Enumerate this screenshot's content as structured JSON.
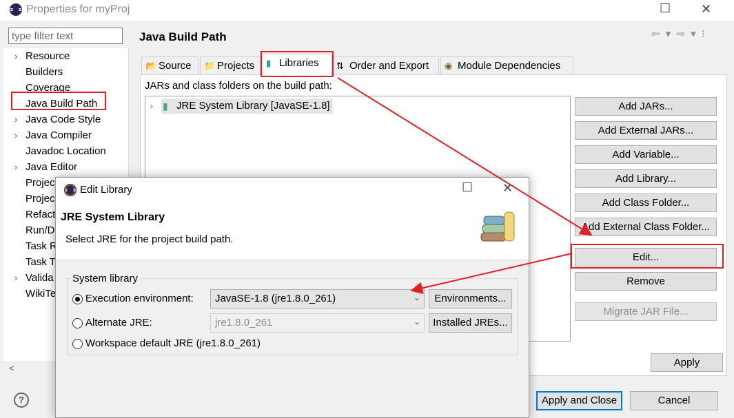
{
  "window": {
    "title": "Properties for myProj",
    "minimize": "—",
    "maximize": "☐",
    "close": "✕"
  },
  "filter": {
    "placeholder": "type filter text"
  },
  "tree": {
    "items": [
      {
        "label": "Resource",
        "arrow": true
      },
      {
        "label": "Builders",
        "arrow": false
      },
      {
        "label": "Coverage",
        "arrow": false
      },
      {
        "label": "Java Build Path",
        "arrow": false,
        "selected": true
      },
      {
        "label": "Java Code Style",
        "arrow": true
      },
      {
        "label": "Java Compiler",
        "arrow": true
      },
      {
        "label": "Javadoc Location",
        "arrow": false
      },
      {
        "label": "Java Editor",
        "arrow": true
      },
      {
        "label": "Projec",
        "arrow": false
      },
      {
        "label": "Projec",
        "arrow": false
      },
      {
        "label": "Refact",
        "arrow": false
      },
      {
        "label": "Run/D",
        "arrow": false
      },
      {
        "label": "Task R",
        "arrow": false
      },
      {
        "label": "Task T",
        "arrow": false
      },
      {
        "label": "Valida",
        "arrow": true
      },
      {
        "label": "WikiTe",
        "arrow": false
      }
    ]
  },
  "page": {
    "title": "Java Build Path",
    "nav_arrows": "⇦ ▾ ⇨ ▾ ⁝"
  },
  "tabs": [
    {
      "label": "Source",
      "icon": "source-folder-icon"
    },
    {
      "label": "Projects",
      "icon": "projects-icon"
    },
    {
      "label": "Libraries",
      "icon": "libraries-icon",
      "active": true
    },
    {
      "label": "Order and Export",
      "icon": "order-export-icon"
    },
    {
      "label": "Module Dependencies",
      "icon": "module-icon"
    }
  ],
  "libraries": {
    "caption": "JARs and class folders on the build path:",
    "entries": [
      {
        "label": "JRE System Library [JavaSE-1.8]"
      }
    ]
  },
  "buttons": {
    "add_jars": "Add JARs...",
    "add_external_jars": "Add External JARs...",
    "add_variable": "Add Variable...",
    "add_library": "Add Library...",
    "add_class_folder": "Add Class Folder...",
    "add_external_class_folder": "Add External Class Folder...",
    "edit": "Edit...",
    "remove": "Remove",
    "migrate_jar": "Migrate JAR File...",
    "apply": "Apply",
    "apply_and_close": "Apply and Close",
    "cancel": "Cancel",
    "help": "?"
  },
  "dialog": {
    "title": "Edit Library",
    "heading": "JRE System Library",
    "description": "Select JRE for the project build path.",
    "group_label": "System library",
    "options": {
      "execution_env": {
        "label": "Execution environment:",
        "value": "JavaSE-1.8 (jre1.8.0_261)",
        "button": "Environments...",
        "checked": true
      },
      "alternate_jre": {
        "label": "Alternate JRE:",
        "value": "jre1.8.0_261",
        "button": "Installed JREs...",
        "checked": false
      },
      "workspace_default": {
        "label": "Workspace default JRE (jre1.8.0_261)",
        "checked": false
      }
    }
  },
  "colors": {
    "highlight": "#e31e24",
    "focus": "#0078d7"
  }
}
